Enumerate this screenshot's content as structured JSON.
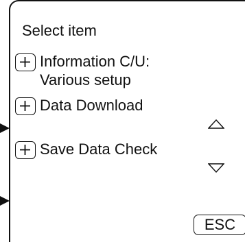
{
  "screen": {
    "title": "Select item"
  },
  "menu": {
    "items": [
      {
        "label_line1": "Information C/U:",
        "label_line2": "Various setup",
        "icon": "plus-icon"
      },
      {
        "label_line1": "Data Download",
        "icon": "plus-icon"
      },
      {
        "label_line1": "Save Data Check",
        "icon": "plus-icon"
      }
    ]
  },
  "scroll": {
    "up_icon": "triangle-up-icon",
    "down_icon": "triangle-down-icon"
  },
  "esc": {
    "label": "ESC"
  }
}
